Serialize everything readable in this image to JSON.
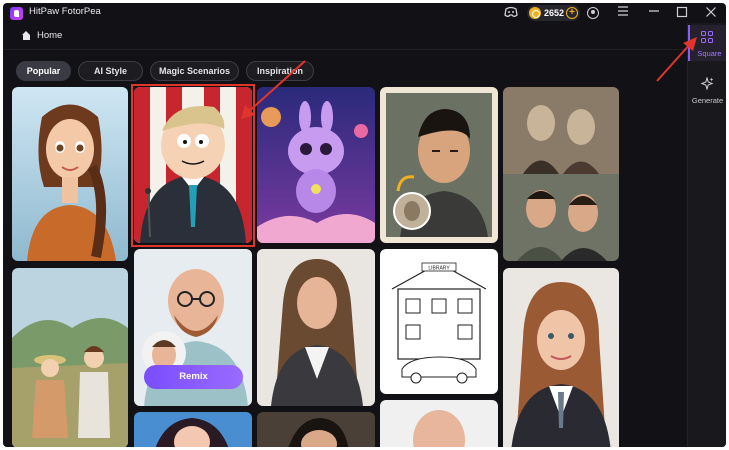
{
  "app": {
    "title": "HitPaw FotorPea"
  },
  "titlebar": {
    "coins": "2652",
    "coin_add": "+",
    "icons": [
      "discord-icon",
      "coin-icon",
      "user-icon",
      "menu-icon",
      "minimize-icon",
      "maximize-icon",
      "close-icon"
    ]
  },
  "header": {
    "home_label": "Home"
  },
  "tabs": [
    {
      "label": "Popular",
      "active": true
    },
    {
      "label": "AI Style",
      "active": false
    },
    {
      "label": "Magic Scenarios",
      "active": false
    },
    {
      "label": "Inspiration",
      "active": false
    }
  ],
  "sidebar": {
    "items": [
      {
        "label": "Square",
        "icon": "grid-icon",
        "active": true
      },
      {
        "label": "Generate",
        "icon": "sparkle-icon",
        "active": false
      }
    ]
  },
  "gallery": {
    "remix_label": "Remix",
    "sign_text": "LIBRARY"
  },
  "colors": {
    "accent": "#8b5cf6",
    "annotation": "#e0352b",
    "coin": "#f2b01e",
    "background": "#121216"
  }
}
